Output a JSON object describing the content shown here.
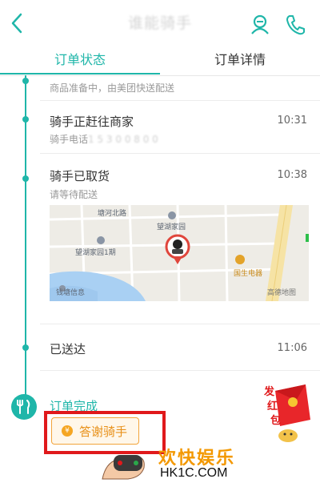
{
  "header": {
    "title": "谁能骑手",
    "back_icon": "chevron-left-icon",
    "rider_icon": "rider-icon",
    "phone_icon": "phone-icon"
  },
  "tabs": [
    {
      "label": "订单状态",
      "active": true
    },
    {
      "label": "订单详情",
      "active": false
    }
  ],
  "timeline": [
    {
      "title": "",
      "subtitle": "商品准备中，由美团快送配送",
      "time": ""
    },
    {
      "title": "骑手正赶往商家",
      "subtitle": "骑手电话",
      "time": "10:31"
    },
    {
      "title": "骑手已取货",
      "subtitle": "请等待配送",
      "time": "10:38"
    },
    {
      "title": "已送达",
      "subtitle": "",
      "time": "11:06"
    },
    {
      "title": "订单完成",
      "subtitle": "",
      "time": ""
    }
  ],
  "map": {
    "labels": [
      "塘河北路",
      "望湖家园",
      "望湖家园1期",
      "国生电器",
      "钱塘信息",
      "高德地图"
    ]
  },
  "thanks_button": {
    "label": "答谢骑手",
    "coin_symbol": "¥"
  },
  "redpacket": {
    "text": [
      "发",
      "红",
      "包"
    ]
  },
  "watermark": {
    "title": "欢快娱乐",
    "url": "HK1C.COM"
  },
  "colors": {
    "accent": "#1fb6a9",
    "highlight_outline": "#e0191b",
    "thanks_text": "#e8911a",
    "watermark": "#f39800"
  }
}
